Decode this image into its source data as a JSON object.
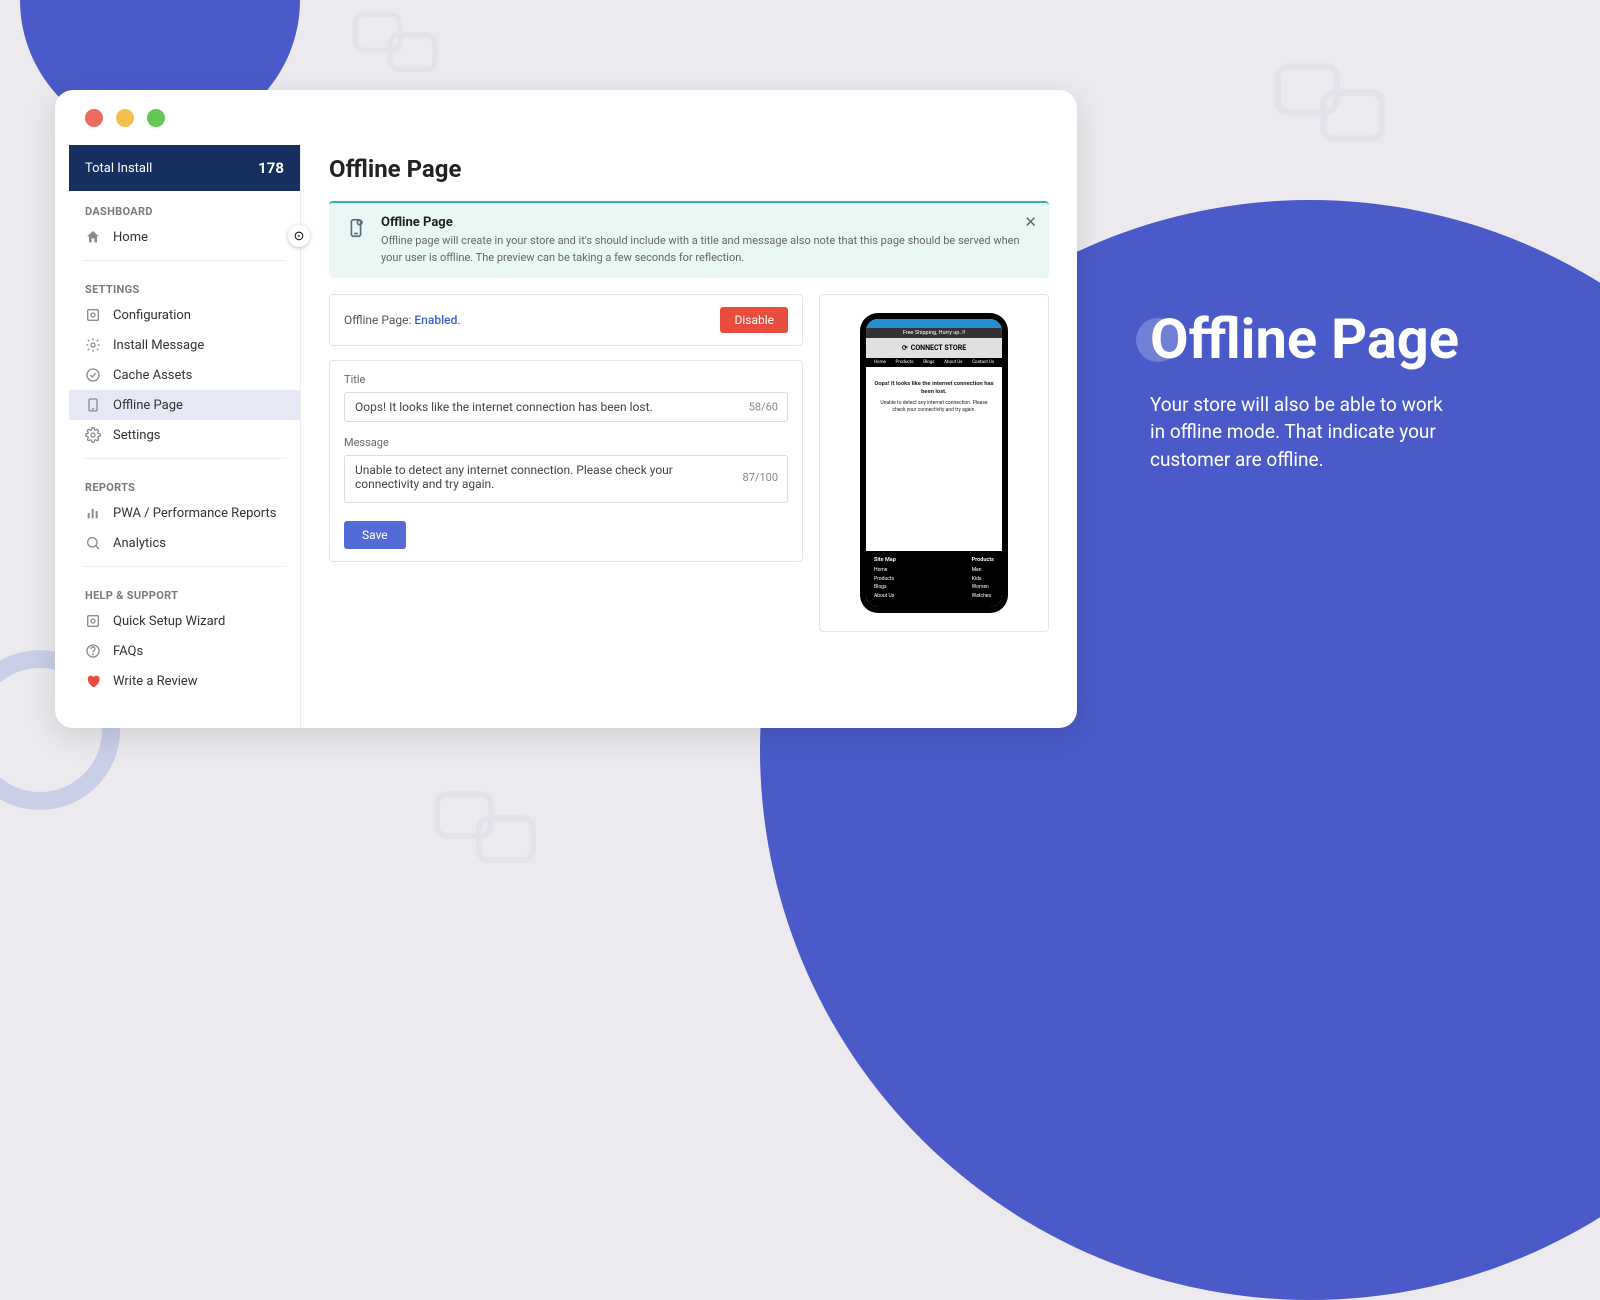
{
  "sidebar": {
    "install_label": "Total Install",
    "install_count": "178",
    "sec_dashboard": "DASHBOARD",
    "home": "Home",
    "sec_settings": "SETTINGS",
    "configuration": "Configuration",
    "install_message": "Install Message",
    "cache_assets": "Cache Assets",
    "offline_page": "Offline Page",
    "settings": "Settings",
    "sec_reports": "REPORTS",
    "pwa_reports": "PWA / Performance Reports",
    "analytics": "Analytics",
    "sec_help": "HELP & SUPPORT",
    "quick_setup": "Quick Setup Wizard",
    "faqs": "FAQs",
    "review": "Write a Review"
  },
  "page": {
    "title": "Offline Page",
    "banner_title": "Offline Page",
    "banner_text": "Offline page will create in your store and it's should include with a title and message also note that this page should be served when your user is offline. The preview can be taking a few seconds for reflection.",
    "status_label": "Offline Page: ",
    "status_value": "Enabled",
    "disable_btn": "Disable",
    "title_label": "Title",
    "title_value": "Oops! It looks like the internet connection has been lost.",
    "title_count": "58/60",
    "message_label": "Message",
    "message_value": "Unable to detect any internet connection. Please check your connectivity and try again.",
    "message_count": "87/100",
    "save_btn": "Save"
  },
  "preview": {
    "promo": "Free Shipping, Hurry up..!!",
    "brand": "CONNECT STORE",
    "nav": {
      "home": "Home",
      "products": "Products",
      "blogs": "Blogs",
      "about": "About Us",
      "contact": "Contact Us"
    },
    "title": "Oops! It looks like the internet connection has been lost.",
    "msg": "Unable to detect any internet connection. Please check your connectivity and try again.",
    "footer": {
      "col1h": "Site Map",
      "c1a": "Home",
      "c1b": "Products",
      "c1c": "Blogs",
      "c1d": "About Us",
      "col2h": "Products",
      "c2a": "Men",
      "c2b": "Kids",
      "c2c": "Women",
      "c2d": "Watches"
    }
  },
  "slide": {
    "title": "Offline Page",
    "body": "Your store will also be able to work in offline mode. That indicate your customer are offline."
  }
}
